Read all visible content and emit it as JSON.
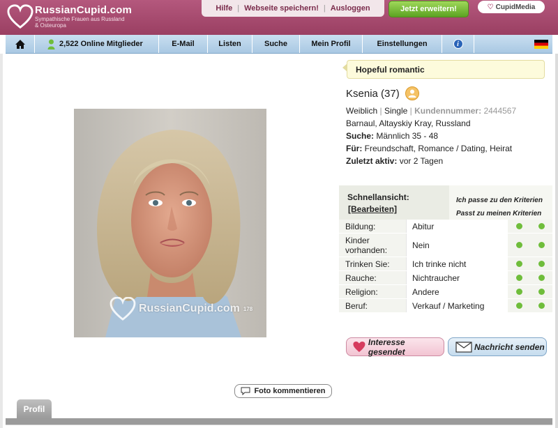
{
  "header": {
    "logo_name": "RussianCupid.com",
    "logo_tag_line1": "Sympathische Frauen aus Russland",
    "logo_tag_line2": "& Osteuropa",
    "links": [
      "Hilfe",
      "Webseite speichern!",
      "Ausloggen"
    ],
    "upgrade_label": "Jetzt erweitern!",
    "cupidmedia_label": "CupidMedia"
  },
  "nav": {
    "online": "2,522 Online Mitglieder",
    "email": "E-Mail",
    "listen": "Listen",
    "suche": "Suche",
    "profil": "Mein Profil",
    "settings": "Einstellungen"
  },
  "photo": {
    "watermark": "RussianCupid.com",
    "watermark_num": "178"
  },
  "profile": {
    "headline": "Hopeful romantic",
    "name": "Ksenia (37)",
    "gender": "Weiblich",
    "status": "Single",
    "customer_label": "Kundennummer:",
    "customer_number": "2444567",
    "location": "Barnaul, Altayskiy Kray, Russland",
    "seeking_label": "Suche:",
    "seeking": "Männlich 35 - 48",
    "for_label": "Für:",
    "for": "Freundschaft, Romance / Dating, Heirat",
    "last_active_label": "Zuletzt aktiv:",
    "last_active": "vor 2 Tagen"
  },
  "quick_view": {
    "title": "Schnellansicht:",
    "edit": "[Bearbeiten]",
    "match1": "Ich passe zu den Kriterien",
    "match2": "Passt zu meinen Kriterien",
    "rows": [
      {
        "label": "Bildung:",
        "value": "Abitur"
      },
      {
        "label": "Kinder vorhanden:",
        "value": "Nein"
      },
      {
        "label": "Trinken Sie:",
        "value": "Ich trinke nicht"
      },
      {
        "label": "Rauche:",
        "value": "Nichtraucher"
      },
      {
        "label": "Religion:",
        "value": "Andere"
      },
      {
        "label": "Beruf:",
        "value": "Verkauf / Marketing"
      }
    ]
  },
  "actions": {
    "interest": "Interesse gesendet",
    "message": "Nachricht senden",
    "comment": "Foto kommentieren"
  },
  "tabs": {
    "profil": "Profil"
  },
  "colors": {
    "brand": "#9a3f62",
    "nav": "#b7d2ea",
    "match_dot": "#6fbd3b"
  }
}
